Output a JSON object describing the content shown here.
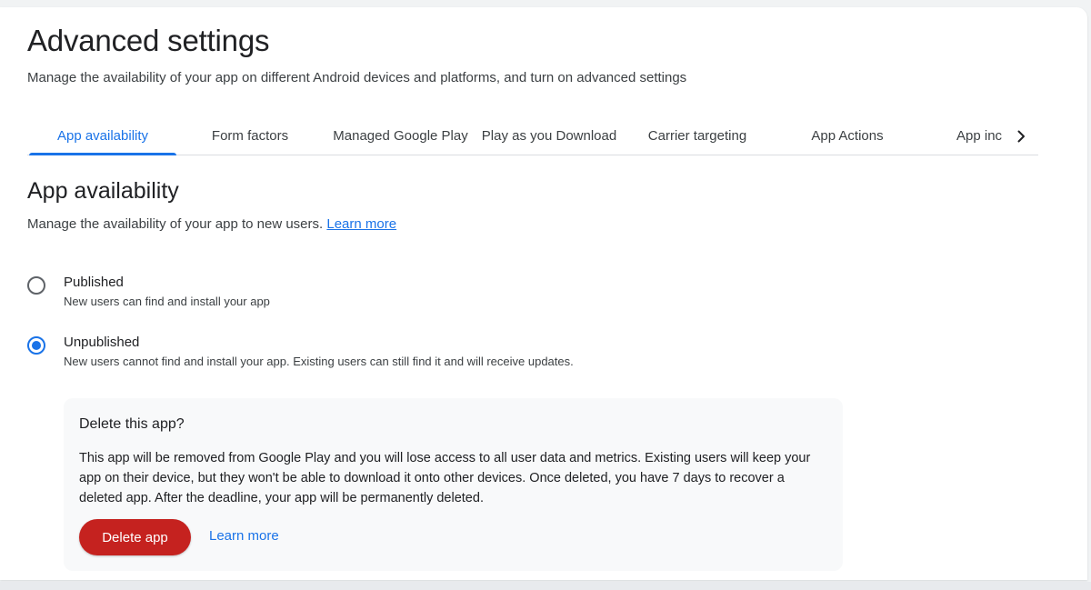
{
  "header": {
    "title": "Advanced settings",
    "subtitle": "Manage the availability of your app on different Android devices and platforms, and turn on advanced settings"
  },
  "tabs": [
    {
      "label": "App availability",
      "active": true
    },
    {
      "label": "Form factors",
      "active": false
    },
    {
      "label": "Managed Google Play",
      "active": false
    },
    {
      "label": "Play as you Download",
      "active": false
    },
    {
      "label": "Carrier targeting",
      "active": false
    },
    {
      "label": "App Actions",
      "active": false
    },
    {
      "label": "App inc",
      "active": false
    }
  ],
  "tabs_scroll_icon": "chevron-right-icon",
  "section": {
    "title": "App availability",
    "description": "Manage the availability of your app to new users.",
    "learn_more": "Learn more"
  },
  "options": [
    {
      "label": "Published",
      "help": "New users can find and install your app",
      "selected": false
    },
    {
      "label": "Unpublished",
      "help": "New users cannot find and install your app. Existing users can still find it and will receive updates.",
      "selected": true
    }
  ],
  "delete_panel": {
    "title": "Delete this app?",
    "body": "This app will be removed from Google Play and you will lose access to all user data and metrics. Existing users will keep your app on their device, but they won't be able to download it onto other devices. Once deleted, you have 7 days to recover a deleted app. After the deadline, your app will be permanently deleted.",
    "delete_button": "Delete app",
    "learn_more": "Learn more"
  },
  "colors": {
    "accent": "#1a73e8",
    "danger": "#c5221f"
  }
}
